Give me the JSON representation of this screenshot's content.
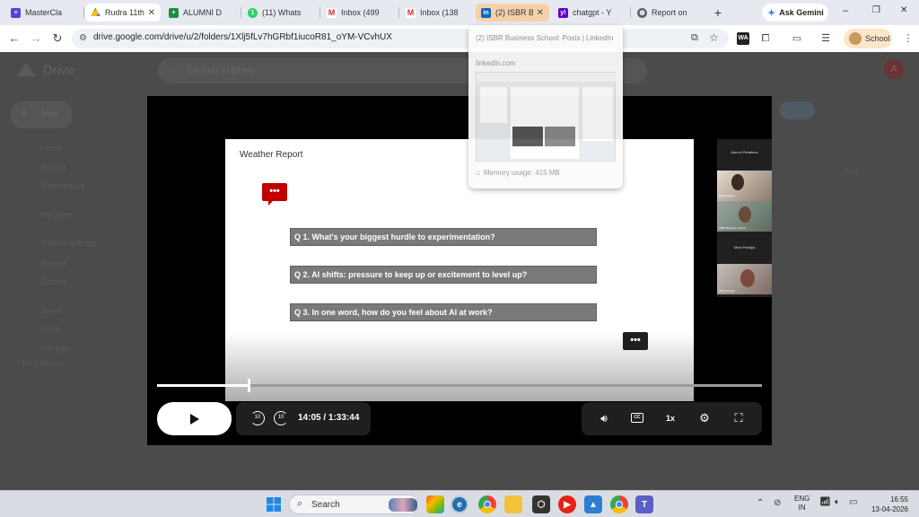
{
  "tabs": [
    {
      "label": "MasterCla",
      "color": "#5b3fd6",
      "icon": "masterclass-icon",
      "state": "normal"
    },
    {
      "label": "Rudra 11th",
      "color": "#1aa260",
      "icon": "google-drive-icon",
      "state": "active"
    },
    {
      "label": "ALUMNI D",
      "color": "#1e8e3e",
      "icon": "google-sheets-icon",
      "state": "normal"
    },
    {
      "label": "(11) Whats",
      "color": "#25d366",
      "icon": "whatsapp-icon",
      "state": "normal"
    },
    {
      "label": "Inbox (499",
      "color": "#d93025",
      "icon": "gmail-icon",
      "state": "normal"
    },
    {
      "label": "Inbox (138",
      "color": "#d93025",
      "icon": "gmail-icon",
      "state": "normal"
    },
    {
      "label": "(2) ISBR Bu",
      "color": "#0a66c2",
      "icon": "linkedin-icon",
      "state": "hover"
    },
    {
      "label": "chatgpt - Y",
      "color": "#6001d2",
      "icon": "yahoo-icon",
      "state": "normal"
    },
    {
      "label": "Report on",
      "color": "#5f6368",
      "icon": "globe-icon",
      "state": "normal"
    }
  ],
  "new_tab_label": "+",
  "ask_gemini_label": "Ask Gemini",
  "window_controls": {
    "minimize": "–",
    "maximize": "❐",
    "close": "✕"
  },
  "address_bar": {
    "url": "drive.google.com/drive/u/2/folders/1Xlj5fLv7hGRbf1iucoR81_oYM-VCvhUX",
    "profile_label": "School"
  },
  "drive": {
    "app_name": "Drive",
    "search_placeholder": "Search in Drive",
    "new_label": "New",
    "nav": [
      "Home",
      "Activity",
      "Workspaces",
      "My Drive",
      "Shared with me",
      "Recent",
      "Starred",
      "Spam",
      "Trash",
      "Storage"
    ],
    "storage_text": "404.5 MB used",
    "sort_label": "Sort",
    "avatar_letter": "A"
  },
  "tab_preview": {
    "title": "(2) ISBR Business School: Posts | LinkedIn",
    "domain": "linkedin.com",
    "memory": "Memory usage: 415 MB"
  },
  "slide": {
    "title": "Weather Report",
    "questions": [
      "Q 1. What's your biggest hurdle to experimentation?",
      "Q 2. AI shifts: pressure to keep up or excitement to level up?",
      "Q 3. In one word, how do you feel about AI at work?"
    ],
    "accent_color": "#c00000"
  },
  "side_panel": {
    "header": "Alumni Relations",
    "tile1_name": "Rudra Kamat",
    "tile2_name": "ISBR Business School",
    "tile3_label": "Mirat Pandya",
    "tile4_name": "Mirat Pandya"
  },
  "player": {
    "time_display": "14:05 / 1:33:44",
    "progress": 0.15,
    "speed_label": "1x",
    "rewind_label": "10",
    "forward_label": "10"
  },
  "taskbar": {
    "search_placeholder": "Search",
    "lang_top": "ENG",
    "lang_bottom": "IN",
    "time": "16:55",
    "date": "13-04-2026"
  }
}
